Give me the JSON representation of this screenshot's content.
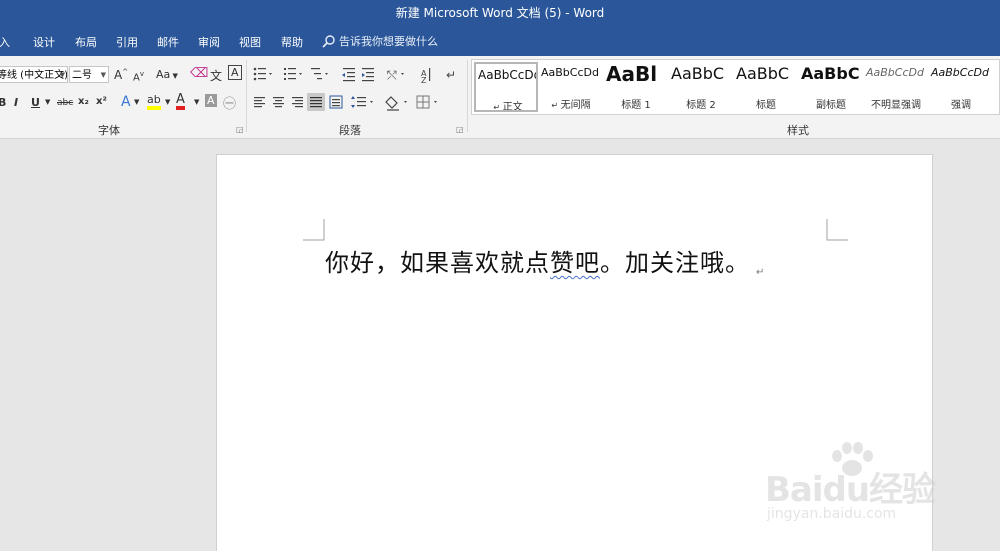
{
  "window": {
    "title": "新建 Microsoft Word 文档 (5)  -  Word"
  },
  "menu": {
    "items": [
      "插入",
      "设计",
      "布局",
      "引用",
      "邮件",
      "审阅",
      "视图",
      "帮助"
    ],
    "tell_me": "告诉我你想要做什么"
  },
  "font_group": {
    "font_name": "等线 (中文正文)",
    "font_size": "二号",
    "grow_glyph": "A",
    "shrink_glyph": "A",
    "change_case": "Aa",
    "bold": "B",
    "italic": "I",
    "underline": "U",
    "strikethrough": "abc",
    "subscript": "x₂",
    "superscript": "x²",
    "label": "字体"
  },
  "paragraph_group": {
    "label": "段落"
  },
  "styles_group": {
    "label": "样式",
    "items": [
      {
        "preview": "AaBbCcDd",
        "name": "正文",
        "selected": true
      },
      {
        "preview": "AaBbCcDd",
        "name": "无间隔"
      },
      {
        "preview": "AaBl",
        "name": "标题 1"
      },
      {
        "preview": "AaBbC",
        "name": "标题 2"
      },
      {
        "preview": "AaBbC",
        "name": "标题"
      },
      {
        "preview": "AaBbC",
        "name": "副标题"
      },
      {
        "preview": "AaBbCcDd",
        "name": "不明显强调"
      },
      {
        "preview": "AaBbCcDd",
        "name": "强调"
      }
    ]
  },
  "document": {
    "text_before": "你好，如果喜欢就点",
    "text_squiggle": "赞吧",
    "text_after": "。加关注哦。",
    "paragraph_mark": "↵"
  },
  "watermark": {
    "brand": "Baidu经验",
    "url": "jingyan.baidu.com"
  },
  "colors": {
    "title_bar": "#2b579a",
    "highlight": "#ffff00",
    "font_color": "#e02020"
  }
}
